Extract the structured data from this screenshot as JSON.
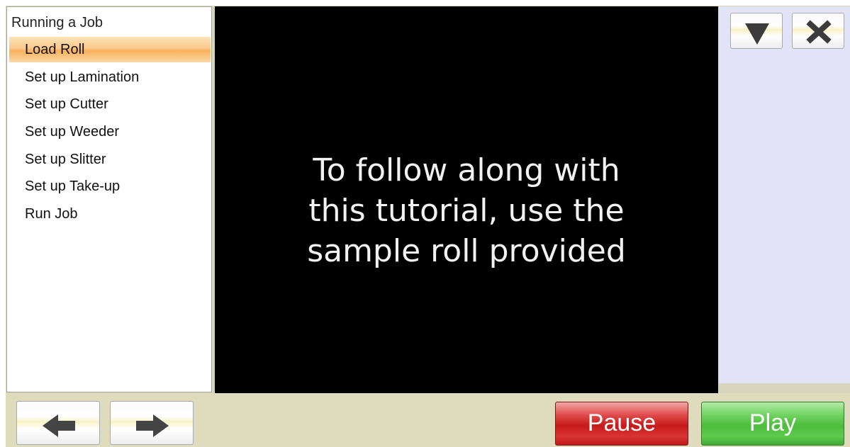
{
  "sidebar": {
    "title": "Running a Job",
    "items": [
      {
        "label": "Load Roll",
        "active": true
      },
      {
        "label": "Set up Lamination",
        "active": false
      },
      {
        "label": "Set up Cutter",
        "active": false
      },
      {
        "label": "Set up Weeder",
        "active": false
      },
      {
        "label": "Set up Slitter",
        "active": false
      },
      {
        "label": "Set up Take-up",
        "active": false
      },
      {
        "label": "Run Job",
        "active": false
      }
    ]
  },
  "video": {
    "caption_lines": [
      "To follow along with",
      "this tutorial, use the",
      "sample roll provided"
    ]
  },
  "window_controls": {
    "collapse_icon": "triangle-down-icon",
    "close_icon": "close-x-icon"
  },
  "navigation": {
    "back_icon": "arrow-left-icon",
    "forward_icon": "arrow-right-icon"
  },
  "playback": {
    "pause_label": "Pause",
    "play_label": "Play"
  },
  "colors": {
    "video_background": "#000000",
    "active_item": "#f8b25e",
    "pause_button": "#c61a1a",
    "play_button": "#4dbd3d",
    "right_panel": "#e3e3f8",
    "bottom_bar": "#dedcbc"
  }
}
